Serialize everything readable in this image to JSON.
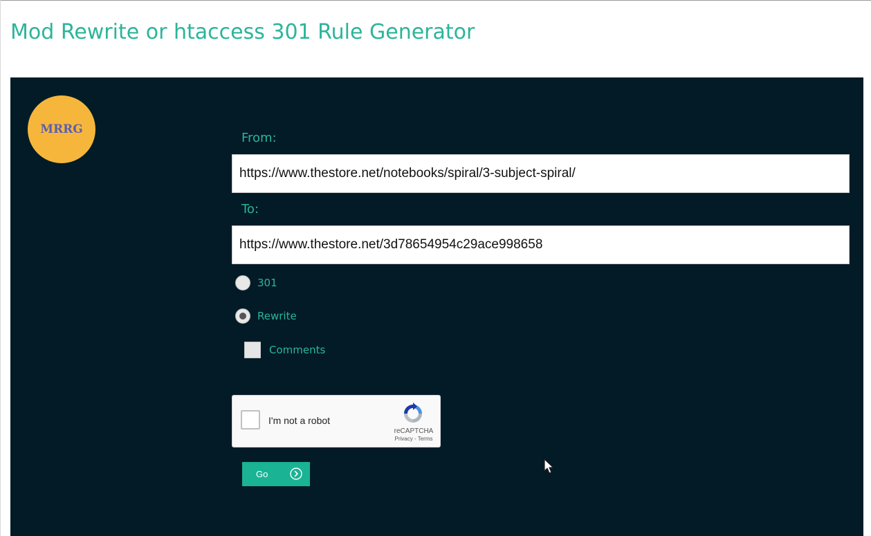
{
  "header": {
    "title": "Mod Rewrite or htaccess 301 Rule Generator"
  },
  "logo": {
    "text": "MRRG"
  },
  "form": {
    "from_label": "From:",
    "from_value": "https://www.thestore.net/notebooks/spiral/3-subject-spiral/",
    "to_label": "To:",
    "to_value": "https://www.thestore.net/3d78654954c29ace998658",
    "redirect_type": {
      "options": [
        "301",
        "Rewrite"
      ],
      "selected": "Rewrite"
    },
    "comments_label": "Comments",
    "comments_checked": false
  },
  "recaptcha": {
    "label": "I'm not a robot",
    "brand": "reCAPTCHA",
    "links": "Privacy - Terms",
    "checked": false
  },
  "submit": {
    "label": "Go",
    "icon": "chevron-circle-right-icon"
  },
  "colors": {
    "accent": "#2bb59a",
    "panel_background": "#031b26",
    "logo_background": "#f6b63c",
    "button_background": "#1ab394"
  }
}
